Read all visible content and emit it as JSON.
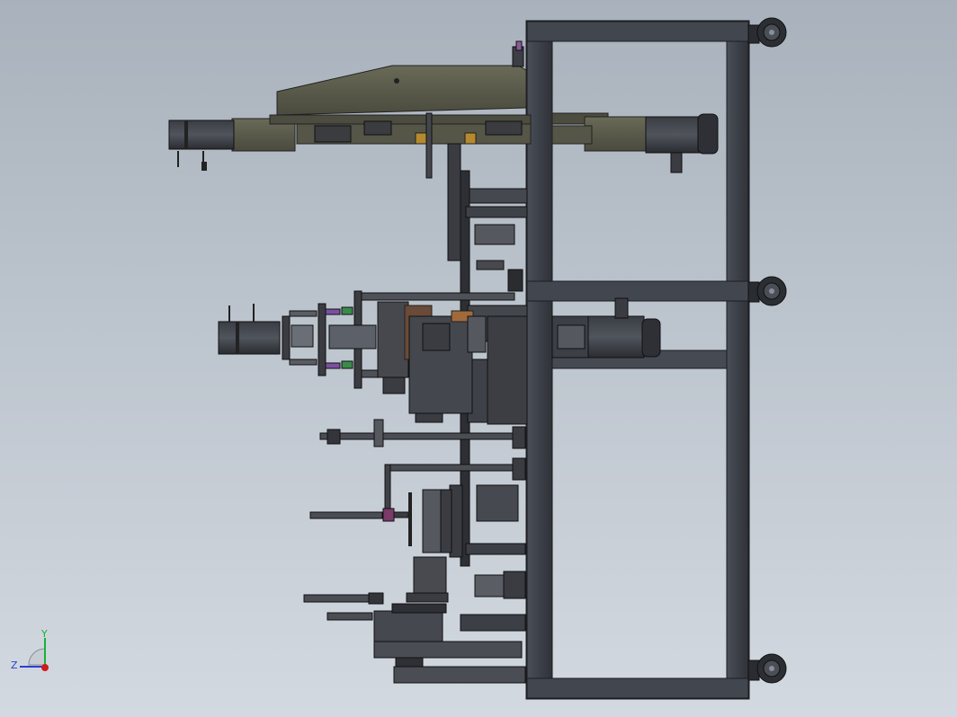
{
  "view": {
    "background_top": "#a9b2bc",
    "background_bottom": "#d3d9e0",
    "frame_color": "#3f434b",
    "frame_edge": "#1c1e22",
    "olive_color": "#5a5a4c",
    "shadow_color": "#2c2f35"
  },
  "triad": {
    "y_label": "Y",
    "z_label": "Z",
    "y_color": "#18b23a",
    "z_color": "#2a3fd1",
    "x_color": "#d11a1a"
  }
}
